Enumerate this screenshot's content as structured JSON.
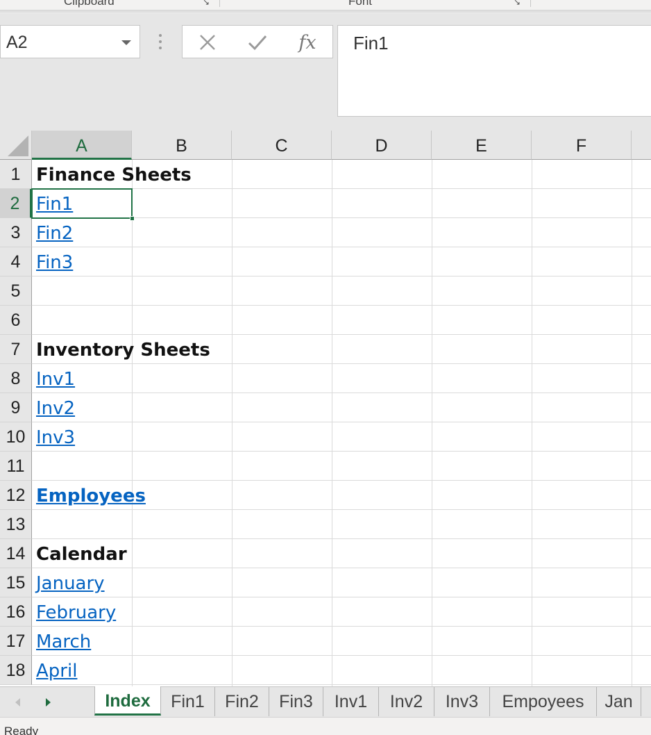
{
  "ribbon": {
    "groups": [
      "Clipboard",
      "Font"
    ]
  },
  "formula_bar": {
    "name_box": "A2",
    "formula": "Fin1",
    "cancel_icon": "x-icon",
    "enter_icon": "check-icon",
    "fx_label": "fx"
  },
  "grid": {
    "columns": [
      "A",
      "B",
      "C",
      "D",
      "E",
      "F"
    ],
    "rows": [
      "1",
      "2",
      "3",
      "4",
      "5",
      "6",
      "7",
      "8",
      "9",
      "10",
      "11",
      "12",
      "13",
      "14",
      "15",
      "16",
      "17",
      "18"
    ],
    "active_cell": "A2",
    "cells": {
      "r1": "Finance Sheets",
      "r2": "Fin1",
      "r3": "Fin2",
      "r4": "Fin3",
      "r7": "Inventory Sheets",
      "r8": "Inv1",
      "r9": "Inv2",
      "r10": "Inv3",
      "r12": "Employees",
      "r14": "Calendar",
      "r15": "January",
      "r16": "February",
      "r17": "March",
      "r18": "April"
    }
  },
  "sheet_tabs": {
    "tabs": [
      "Index",
      "Fin1",
      "Fin2",
      "Fin3",
      "Inv1",
      "Inv2",
      "Inv3",
      "Empoyees",
      "Jan"
    ],
    "active": "Index"
  },
  "status_bar": {
    "text": "Ready"
  },
  "colors": {
    "accent": "#217346",
    "link": "#0563c1"
  }
}
